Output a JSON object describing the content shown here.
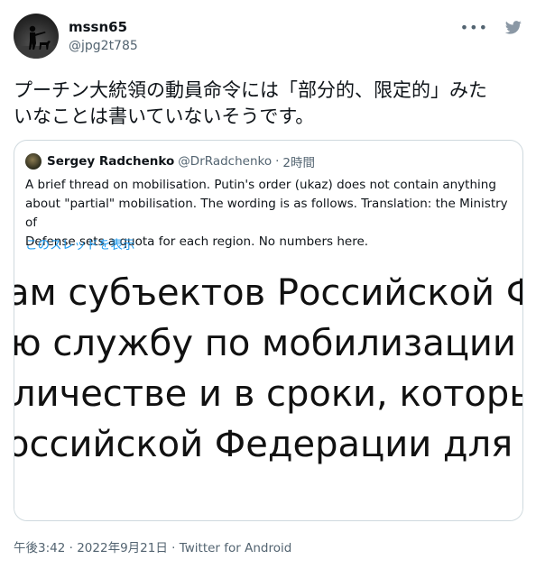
{
  "author": {
    "name": "mssn65",
    "handle": "@jpg2t785"
  },
  "menu": {
    "more_label": "•••"
  },
  "tweet": {
    "line1": "プーチン大統領の動員命令には「部分的、限定的」みた",
    "line2": "いなことは書いていないそうです。"
  },
  "quote": {
    "author_name": "Sergey Radchenko",
    "author_handle": "@DrRadchenko",
    "separator": "·",
    "time": "2時間",
    "body_line1": "A brief thread on mobilisation. Putin's order (ukaz) does not contain anything",
    "body_line2": "about \"partial\" mobilisation. The wording is as follows. Translation: the Ministry of",
    "body_line3": "Defense sets a quota for each region. No numbers here.",
    "show_thread": "このスレッドを表示",
    "image_lines": [
      "ам субъектов Российской Фед",
      "ю службу по мобилизации в В",
      "личестве и в сроки, которые",
      "оссийской Федерации для каж"
    ]
  },
  "footer": {
    "time": "午後3:42",
    "sep": "·",
    "date": "2022年9月21日",
    "source": "Twitter for Android"
  },
  "icons": {
    "more": "more-icon",
    "source": "twitter-bird-icon"
  }
}
